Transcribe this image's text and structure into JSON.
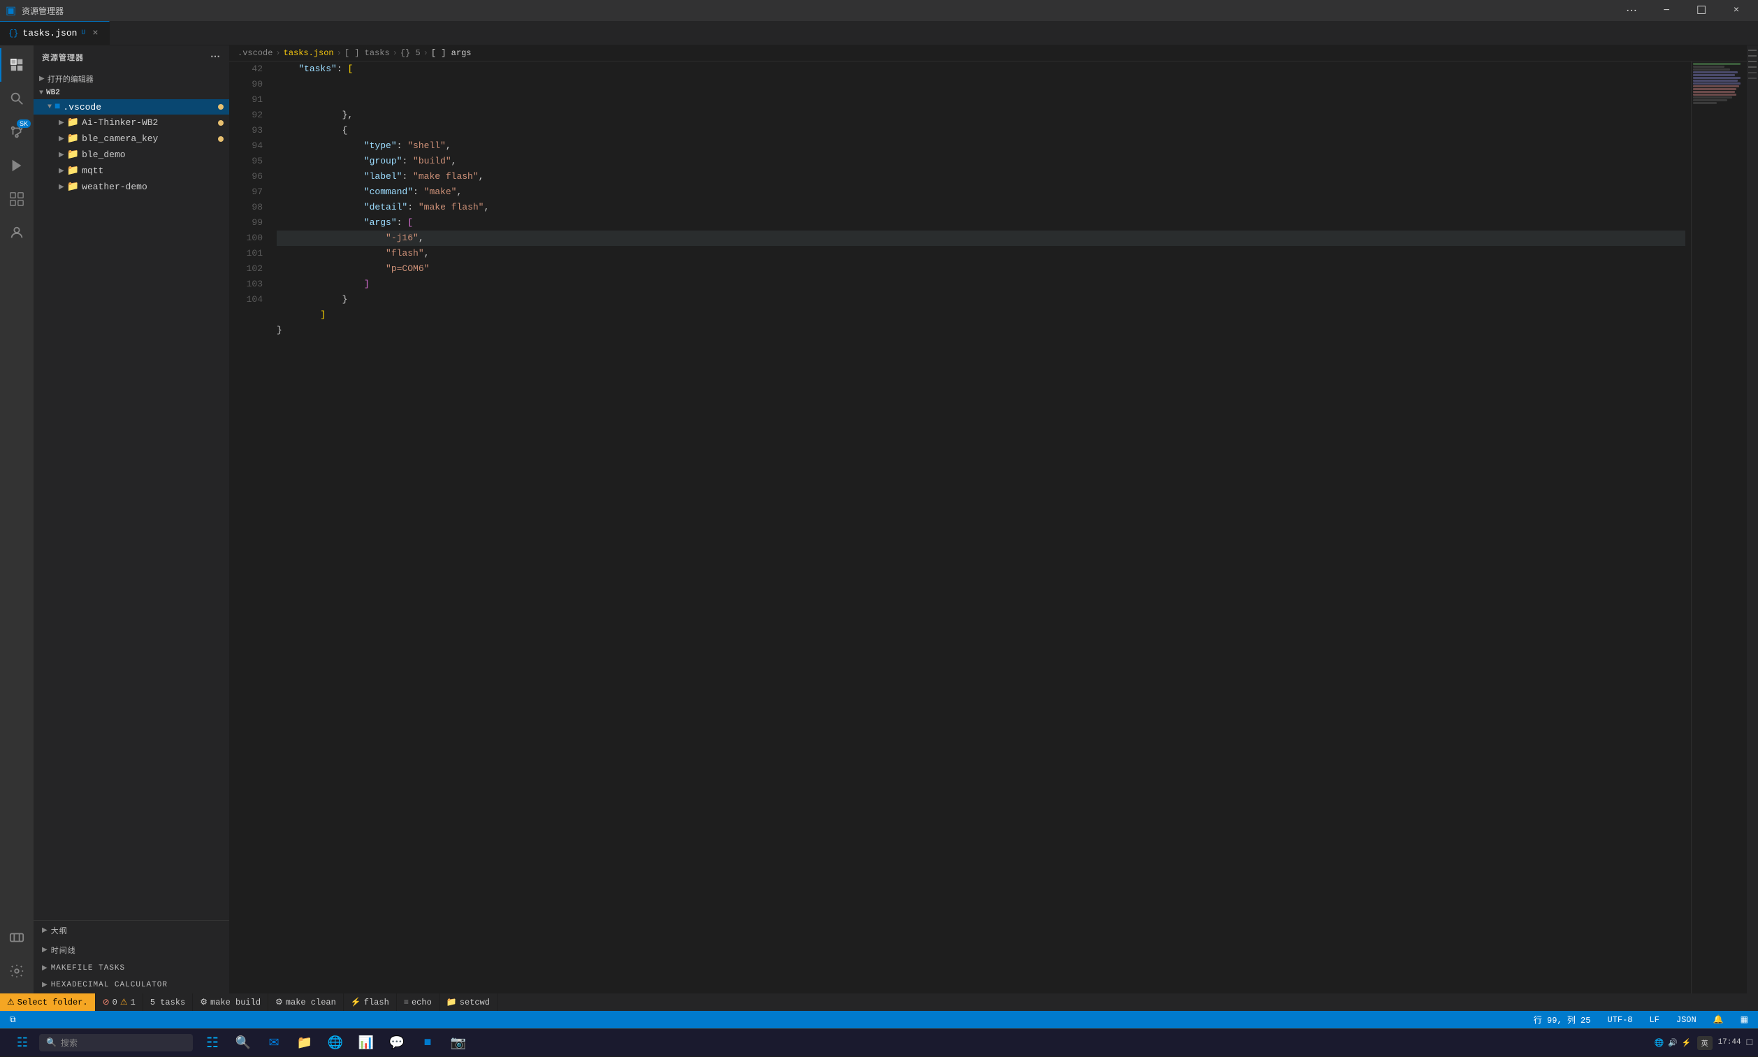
{
  "app": {
    "title": "资源管理器",
    "window_controls": [
      "minimize",
      "maximize",
      "close"
    ]
  },
  "title_bar": {
    "icon": "⚙",
    "title": "资源管理器",
    "more_icon": "⋯"
  },
  "tabs": [
    {
      "id": "tasks-json",
      "label": "tasks.json",
      "icon": "{}",
      "modified": true,
      "active": true,
      "close": "×"
    }
  ],
  "breadcrumb": {
    "items": [
      ".vscode",
      "tasks.json",
      "[ ] tasks",
      "{} 5",
      "[ ] args"
    ]
  },
  "activity_bar": {
    "items": [
      {
        "id": "explorer",
        "icon": "⧉",
        "active": true
      },
      {
        "id": "search",
        "icon": "🔍",
        "active": false
      },
      {
        "id": "source-control",
        "icon": "⑂",
        "active": false,
        "badge": "SK"
      },
      {
        "id": "run",
        "icon": "▷",
        "active": false
      },
      {
        "id": "extensions",
        "icon": "⊞",
        "active": false
      },
      {
        "id": "accounts",
        "icon": "⊙",
        "active": false
      },
      {
        "id": "remote",
        "icon": "⊓",
        "active": false
      }
    ],
    "bottom": [
      {
        "id": "settings",
        "icon": "⚙"
      },
      {
        "id": "account",
        "icon": "👤"
      }
    ]
  },
  "sidebar": {
    "header": "资源管理器",
    "open_editors_label": "打开的编辑器",
    "root_label": "WB2",
    "tree": [
      {
        "id": "vscode",
        "label": ".vscode",
        "type": "folder",
        "expanded": true,
        "active": true,
        "indent": 1,
        "modified": true
      },
      {
        "id": "ai-thinker",
        "label": "Ai-Thinker-WB2",
        "type": "folder",
        "indent": 1,
        "modified": true
      },
      {
        "id": "ble-camera-key",
        "label": "ble_camera_key",
        "type": "folder",
        "indent": 1,
        "modified": true
      },
      {
        "id": "ble-demo",
        "label": "ble_demo",
        "type": "folder",
        "indent": 1,
        "modified": false
      },
      {
        "id": "mqtt",
        "label": "mqtt",
        "type": "folder",
        "indent": 1,
        "modified": false
      },
      {
        "id": "weather-demo",
        "label": "weather-demo",
        "type": "folder",
        "indent": 1,
        "modified": false
      }
    ],
    "bottom_panels": [
      {
        "id": "outline",
        "label": "大纲"
      },
      {
        "id": "timeline",
        "label": "时间线"
      },
      {
        "id": "makefile-tasks",
        "label": "MAKEFILE TASKS",
        "warning": false
      },
      {
        "id": "hex-calculator",
        "label": "HEXADECIMAL CALCULATOR",
        "warning": false
      }
    ]
  },
  "editor": {
    "line_start": 42,
    "lines": [
      {
        "num": 42,
        "content_raw": "    \"tasks\": [",
        "tokens": [
          {
            "t": "s-key",
            "v": "    \"tasks\""
          },
          {
            "t": "s-punct",
            "v": ": "
          },
          {
            "t": "s-bracket",
            "v": "["
          }
        ]
      },
      {
        "num": 90,
        "content_raw": "            },",
        "tokens": [
          {
            "t": "s-punct",
            "v": "            },"
          }
        ]
      },
      {
        "num": 91,
        "content_raw": "            {",
        "tokens": [
          {
            "t": "s-punct",
            "v": "            {"
          }
        ]
      },
      {
        "num": 92,
        "content_raw": "                \"type\": \"shell\",",
        "tokens": [
          {
            "t": "s-punct",
            "v": "                "
          },
          {
            "t": "s-key",
            "v": "\"type\""
          },
          {
            "t": "s-punct",
            "v": ": "
          },
          {
            "t": "s-string",
            "v": "\"shell\""
          },
          {
            "t": "s-punct",
            "v": ","
          }
        ]
      },
      {
        "num": 93,
        "content_raw": "                \"group\": \"build\",",
        "tokens": [
          {
            "t": "s-punct",
            "v": "                "
          },
          {
            "t": "s-key",
            "v": "\"group\""
          },
          {
            "t": "s-punct",
            "v": ": "
          },
          {
            "t": "s-string",
            "v": "\"build\""
          },
          {
            "t": "s-punct",
            "v": ","
          }
        ]
      },
      {
        "num": 94,
        "content_raw": "                \"label\": \"make flash\",",
        "tokens": [
          {
            "t": "s-punct",
            "v": "                "
          },
          {
            "t": "s-key",
            "v": "\"label\""
          },
          {
            "t": "s-punct",
            "v": ": "
          },
          {
            "t": "s-string",
            "v": "\"make flash\""
          },
          {
            "t": "s-punct",
            "v": ","
          }
        ]
      },
      {
        "num": 95,
        "content_raw": "                \"command\": \"make\",",
        "tokens": [
          {
            "t": "s-punct",
            "v": "                "
          },
          {
            "t": "s-key",
            "v": "\"command\""
          },
          {
            "t": "s-punct",
            "v": ": "
          },
          {
            "t": "s-string",
            "v": "\"make\""
          },
          {
            "t": "s-punct",
            "v": ","
          }
        ]
      },
      {
        "num": 96,
        "content_raw": "                \"detail\": \"make flash\",",
        "tokens": [
          {
            "t": "s-punct",
            "v": "                "
          },
          {
            "t": "s-key",
            "v": "\"detail\""
          },
          {
            "t": "s-punct",
            "v": ": "
          },
          {
            "t": "s-string",
            "v": "\"make flash\""
          },
          {
            "t": "s-punct",
            "v": ","
          }
        ]
      },
      {
        "num": 97,
        "content_raw": "                \"args\": [",
        "tokens": [
          {
            "t": "s-punct",
            "v": "                "
          },
          {
            "t": "s-key",
            "v": "\"args\""
          },
          {
            "t": "s-punct",
            "v": ": "
          },
          {
            "t": "s-bracket2",
            "v": "["
          }
        ]
      },
      {
        "num": 98,
        "content_raw": "                    \"-j16\",",
        "tokens": [
          {
            "t": "s-punct",
            "v": "                    "
          },
          {
            "t": "s-string",
            "v": "\"-j16\""
          },
          {
            "t": "s-punct",
            "v": ","
          }
        ],
        "highlighted": true
      },
      {
        "num": 99,
        "content_raw": "                    \"flash\",",
        "tokens": [
          {
            "t": "s-punct",
            "v": "                    "
          },
          {
            "t": "s-string",
            "v": "\"flash\""
          },
          {
            "t": "s-punct",
            "v": ","
          }
        ]
      },
      {
        "num": 100,
        "content_raw": "                    \"p=COM6\"",
        "tokens": [
          {
            "t": "s-punct",
            "v": "                    "
          },
          {
            "t": "s-string",
            "v": "\"p=COM6\""
          }
        ]
      },
      {
        "num": 101,
        "content_raw": "                ]",
        "tokens": [
          {
            "t": "s-bracket2",
            "v": "                ]"
          }
        ]
      },
      {
        "num": 102,
        "content_raw": "            }",
        "tokens": [
          {
            "t": "s-punct",
            "v": "            }"
          }
        ]
      },
      {
        "num": 103,
        "content_raw": "        ]",
        "tokens": [
          {
            "t": "s-bracket",
            "v": "        ]"
          }
        ]
      },
      {
        "num": 104,
        "content_raw": "}",
        "tokens": [
          {
            "t": "s-punct",
            "v": "}"
          }
        ]
      }
    ]
  },
  "status_bar": {
    "left": [
      {
        "id": "remote",
        "icon": "⊓",
        "label": ""
      },
      {
        "id": "folder-select",
        "label": "⚠ Select folder."
      },
      {
        "id": "errors",
        "icon": "⊗",
        "errors": "0",
        "warnings": "1"
      },
      {
        "id": "tasks-count",
        "label": "5 tasks"
      }
    ],
    "tasks": [
      {
        "id": "make-build",
        "label": "make build",
        "icon": "⚙"
      },
      {
        "id": "make-clean",
        "label": "make clean",
        "icon": "⚙"
      },
      {
        "id": "flash",
        "label": "flash",
        "icon": "⚡"
      },
      {
        "id": "echo",
        "label": "echo",
        "icon": "≡"
      },
      {
        "id": "setcwd",
        "label": "setcwd",
        "icon": "📁"
      }
    ],
    "right": [
      {
        "id": "cursor",
        "label": "行 99, 列 25"
      },
      {
        "id": "encoding",
        "label": "UTF-8"
      },
      {
        "id": "line-ending",
        "label": "LF"
      },
      {
        "id": "language",
        "label": "JSON"
      },
      {
        "id": "notifications",
        "icon": "🔔"
      },
      {
        "id": "layout",
        "icon": "▦"
      }
    ],
    "time": "17:44"
  },
  "windows_taskbar": {
    "apps": [
      "⊞",
      "🔍",
      "✉",
      "📁",
      "🌐",
      "📊",
      "💬",
      "📷"
    ],
    "tray": [
      "英",
      "17:44"
    ],
    "language": "英"
  }
}
